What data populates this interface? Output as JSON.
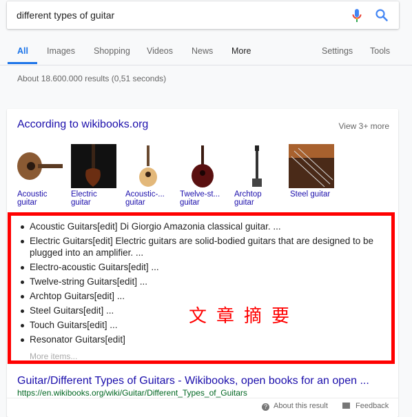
{
  "search": {
    "query": "different types of guitar"
  },
  "tabs": {
    "all": "All",
    "images": "Images",
    "shopping": "Shopping",
    "videos": "Videos",
    "news": "News",
    "more": "More",
    "settings": "Settings",
    "tools": "Tools"
  },
  "stats": "About 18.600.000 results (0,51 seconds)",
  "card": {
    "title": "According to wikibooks.org",
    "view_more": "View 3+ more",
    "thumbnails": [
      {
        "label": "Acoustic guitar"
      },
      {
        "label": "Electric guitar"
      },
      {
        "label": "Acoustic-... guitar"
      },
      {
        "label": "Twelve-st... guitar"
      },
      {
        "label": "Archtop guitar"
      },
      {
        "label": "Steel guitar"
      }
    ],
    "list": [
      "Acoustic Guitars[edit] Di Giorgio Amazonia classical guitar. ...",
      "Electric Guitars[edit] Electric guitars are solid-bodied guitars that are designed to be plugged into an amplifier. ...",
      "Electro-acoustic Guitars[edit] ...",
      "Twelve-string Guitars[edit] ...",
      "Archtop Guitars[edit] ...",
      "Steel Guitars[edit] ...",
      "Touch Guitars[edit] ...",
      "Resonator Guitars[edit]"
    ],
    "more_items": "More items...",
    "annotation": "文章摘要",
    "result_title": "Guitar/Different Types of Guitars - Wikibooks, open books for an open ...",
    "result_url": "https://en.wikibooks.org/wiki/Guitar/Different_Types_of_Guitars",
    "about": "About this result",
    "feedback": "Feedback"
  },
  "colors": {
    "link": "#1a0dab",
    "accent": "#1a73e8",
    "highlight": "#ff0000",
    "url": "#006621"
  }
}
